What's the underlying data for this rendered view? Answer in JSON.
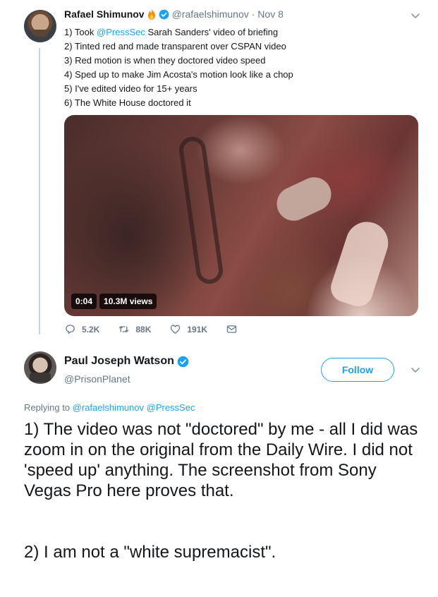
{
  "tweet1": {
    "name": "Rafael Shimunov",
    "handle": "@rafaelshimunov",
    "date": "· Nov 8",
    "lines": [
      {
        "prefix": "1) Took ",
        "mention": "@PressSec",
        "suffix": " Sarah Sanders' video of briefing"
      },
      {
        "text": "2) Tinted red and made transparent over CSPAN video"
      },
      {
        "text": "3) Red motion is when they doctored video speed"
      },
      {
        "text": "4) Sped up to make Jim Acosta's motion look like a chop"
      },
      {
        "text": "5) I've edited video for 15+ years"
      },
      {
        "text": "6) The White House doctored it"
      }
    ],
    "video": {
      "time": "0:04",
      "views": "10.3M views"
    },
    "stats": {
      "replies": "5.2K",
      "retweets": "88K",
      "likes": "191K"
    },
    "icons": [
      "flame-emoji-icon",
      "verified-badge-icon",
      "chevron-down-icon",
      "reply-icon",
      "retweet-icon",
      "like-icon",
      "dm-icon"
    ]
  },
  "tweet2": {
    "name": "Paul Joseph Watson",
    "handle": "@PrisonPlanet",
    "follow_label": "Follow",
    "replying_prefix": "Replying to ",
    "replying_to": "@rafaelshimunov @PressSec",
    "paragraph1": "1) The video was not \"doctored\" by me - all I did was zoom in on the original from the Daily Wire. I did not 'speed up' anything. The screenshot from Sony Vegas Pro here proves that.",
    "paragraph2": "2) I am not a \"white supremacist\"."
  },
  "colors": {
    "accent": "#1da1f2",
    "muted": "#657786",
    "text": "#14171a",
    "thread_line": "#ccd6dd",
    "flame": "#f4900c"
  }
}
